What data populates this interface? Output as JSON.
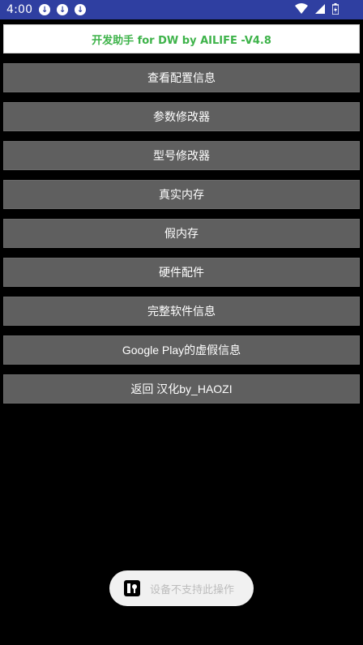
{
  "status_bar": {
    "time": "4:00",
    "icons": [
      "download-icon",
      "download-icon",
      "download-icon",
      "wifi-icon",
      "signal-icon",
      "battery-icon"
    ],
    "background": "#2f3fa1"
  },
  "header": {
    "title": "开发助手 for DW by AILIFE -V4.8",
    "color": "#3eb34a"
  },
  "menu": {
    "buttons": [
      {
        "label": "查看配置信息"
      },
      {
        "label": "参数修改器"
      },
      {
        "label": "型号修改器"
      },
      {
        "label": "真实内存"
      },
      {
        "label": "假内存"
      },
      {
        "label": "硬件配件"
      },
      {
        "label": "完整软件信息"
      },
      {
        "label": "Google Play的虚假信息"
      },
      {
        "label": "返回 汉化by_HAOZI"
      }
    ],
    "button_color": "#5f5f5f"
  },
  "toast": {
    "text": "设备不支持此操作",
    "icon": "app-icon"
  }
}
